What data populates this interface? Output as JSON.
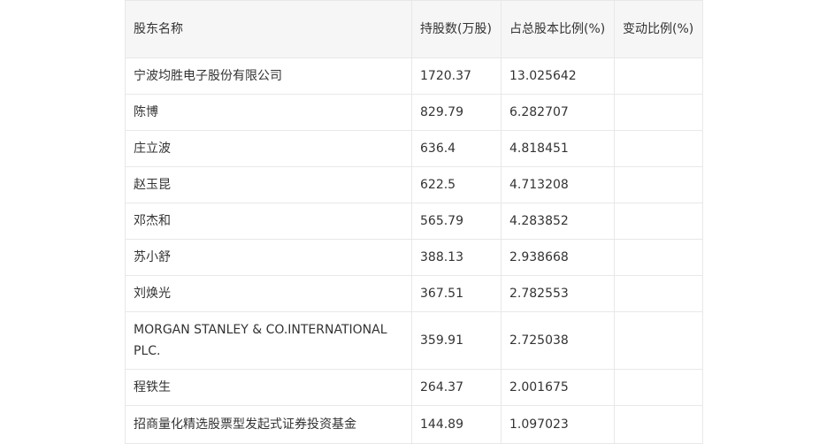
{
  "table": {
    "headers": [
      "股东名称",
      "持股数(万股)",
      "占总股本比例(%)",
      "变动比例(%)"
    ],
    "rows": [
      {
        "name": "宁波均胜电子股份有限公司",
        "shares": "1720.37",
        "ratio": "13.025642",
        "change": ""
      },
      {
        "name": "陈博",
        "shares": "829.79",
        "ratio": "6.282707",
        "change": ""
      },
      {
        "name": "庄立波",
        "shares": "636.4",
        "ratio": "4.818451",
        "change": ""
      },
      {
        "name": "赵玉昆",
        "shares": "622.5",
        "ratio": "4.713208",
        "change": ""
      },
      {
        "name": "邓杰和",
        "shares": "565.79",
        "ratio": "4.283852",
        "change": ""
      },
      {
        "name": "苏小舒",
        "shares": "388.13",
        "ratio": "2.938668",
        "change": ""
      },
      {
        "name": "刘焕光",
        "shares": "367.51",
        "ratio": "2.782553",
        "change": ""
      },
      {
        "name": "MORGAN STANLEY & CO.INTERNATIONAL PLC.",
        "shares": "359.91",
        "ratio": "2.725038",
        "change": ""
      },
      {
        "name": "程铁生",
        "shares": "264.37",
        "ratio": "2.001675",
        "change": ""
      },
      {
        "name": "招商量化精选股票型发起式证券投资基金",
        "shares": "144.89",
        "ratio": "1.097023",
        "change": ""
      }
    ]
  }
}
